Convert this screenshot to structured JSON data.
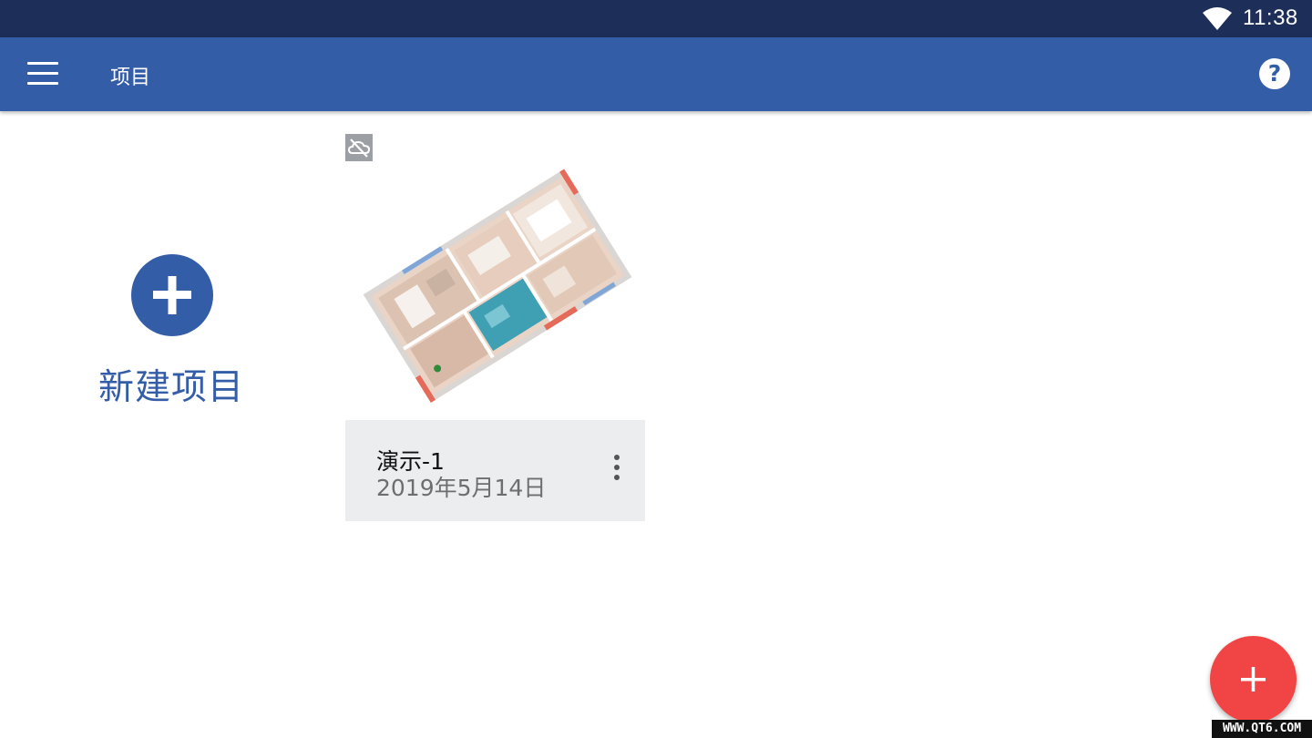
{
  "status_bar": {
    "time": "11:38",
    "wifi_icon": "wifi-icon"
  },
  "app_bar": {
    "menu_icon": "hamburger-menu-icon",
    "title": "项目",
    "help_icon": "help-icon",
    "help_glyph": "?"
  },
  "new_project": {
    "icon": "plus-circle-icon",
    "label": "新建项目"
  },
  "projects": [
    {
      "cloud_icon": "cloud-off-icon",
      "thumbnail": "3d-floor-plan-thumbnail",
      "name": "演示-1",
      "date": "2019年5月14日",
      "menu_icon": "more-vert-icon"
    }
  ],
  "fab": {
    "icon": "plus-icon"
  },
  "watermark": {
    "text": "WWW.QT6.COM"
  },
  "colors": {
    "status_bar": "#1d2f58",
    "app_bar": "#345da8",
    "accent_blue": "#345da8",
    "card_bg": "#ecedef",
    "fab": "#f14545"
  }
}
